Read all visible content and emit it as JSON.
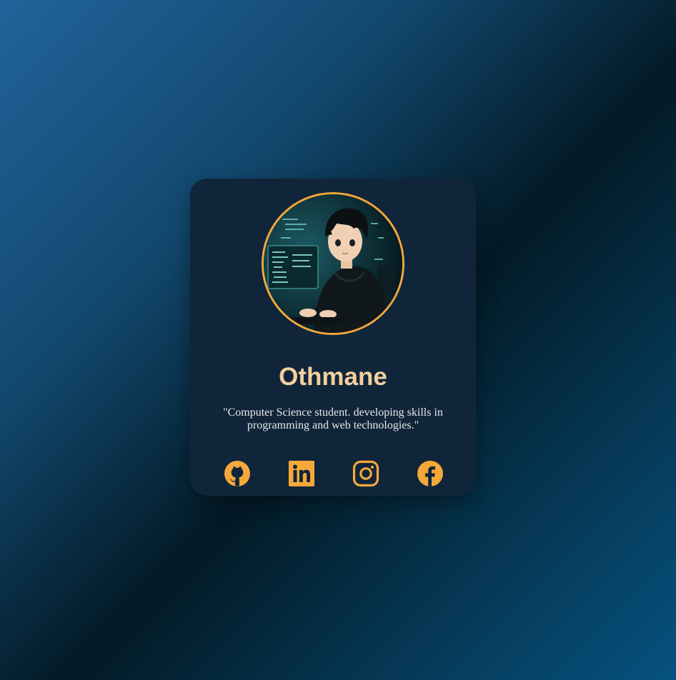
{
  "profile": {
    "name": "Othmane",
    "bio": "\"Computer Science student. developing skills in programming and web technologies.\"",
    "avatar_icon": "coder-avatar-illustration"
  },
  "social_links": [
    {
      "icon": "github-icon",
      "label": "GitHub"
    },
    {
      "icon": "linkedin-icon",
      "label": "LinkedIn"
    },
    {
      "icon": "instagram-icon",
      "label": "Instagram"
    },
    {
      "icon": "facebook-icon",
      "label": "Facebook"
    }
  ],
  "colors": {
    "accent": "#f5a83a",
    "name_text": "#f3cf9c",
    "card_background": "#10253a",
    "bio_text": "#e7e7e7"
  }
}
